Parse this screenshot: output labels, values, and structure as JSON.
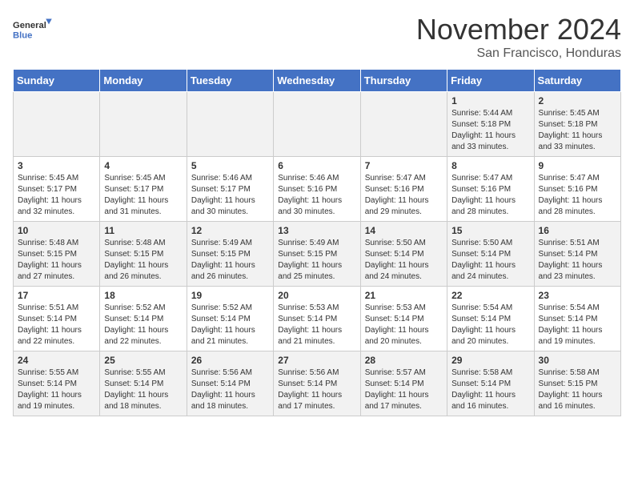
{
  "logo": {
    "line1": "General",
    "line2": "Blue"
  },
  "title": "November 2024",
  "subtitle": "San Francisco, Honduras",
  "weekdays": [
    "Sunday",
    "Monday",
    "Tuesday",
    "Wednesday",
    "Thursday",
    "Friday",
    "Saturday"
  ],
  "weeks": [
    [
      {
        "day": "",
        "info": ""
      },
      {
        "day": "",
        "info": ""
      },
      {
        "day": "",
        "info": ""
      },
      {
        "day": "",
        "info": ""
      },
      {
        "day": "",
        "info": ""
      },
      {
        "day": "1",
        "info": "Sunrise: 5:44 AM\nSunset: 5:18 PM\nDaylight: 11 hours and 33 minutes."
      },
      {
        "day": "2",
        "info": "Sunrise: 5:45 AM\nSunset: 5:18 PM\nDaylight: 11 hours and 33 minutes."
      }
    ],
    [
      {
        "day": "3",
        "info": "Sunrise: 5:45 AM\nSunset: 5:17 PM\nDaylight: 11 hours and 32 minutes."
      },
      {
        "day": "4",
        "info": "Sunrise: 5:45 AM\nSunset: 5:17 PM\nDaylight: 11 hours and 31 minutes."
      },
      {
        "day": "5",
        "info": "Sunrise: 5:46 AM\nSunset: 5:17 PM\nDaylight: 11 hours and 30 minutes."
      },
      {
        "day": "6",
        "info": "Sunrise: 5:46 AM\nSunset: 5:16 PM\nDaylight: 11 hours and 30 minutes."
      },
      {
        "day": "7",
        "info": "Sunrise: 5:47 AM\nSunset: 5:16 PM\nDaylight: 11 hours and 29 minutes."
      },
      {
        "day": "8",
        "info": "Sunrise: 5:47 AM\nSunset: 5:16 PM\nDaylight: 11 hours and 28 minutes."
      },
      {
        "day": "9",
        "info": "Sunrise: 5:47 AM\nSunset: 5:16 PM\nDaylight: 11 hours and 28 minutes."
      }
    ],
    [
      {
        "day": "10",
        "info": "Sunrise: 5:48 AM\nSunset: 5:15 PM\nDaylight: 11 hours and 27 minutes."
      },
      {
        "day": "11",
        "info": "Sunrise: 5:48 AM\nSunset: 5:15 PM\nDaylight: 11 hours and 26 minutes."
      },
      {
        "day": "12",
        "info": "Sunrise: 5:49 AM\nSunset: 5:15 PM\nDaylight: 11 hours and 26 minutes."
      },
      {
        "day": "13",
        "info": "Sunrise: 5:49 AM\nSunset: 5:15 PM\nDaylight: 11 hours and 25 minutes."
      },
      {
        "day": "14",
        "info": "Sunrise: 5:50 AM\nSunset: 5:14 PM\nDaylight: 11 hours and 24 minutes."
      },
      {
        "day": "15",
        "info": "Sunrise: 5:50 AM\nSunset: 5:14 PM\nDaylight: 11 hours and 24 minutes."
      },
      {
        "day": "16",
        "info": "Sunrise: 5:51 AM\nSunset: 5:14 PM\nDaylight: 11 hours and 23 minutes."
      }
    ],
    [
      {
        "day": "17",
        "info": "Sunrise: 5:51 AM\nSunset: 5:14 PM\nDaylight: 11 hours and 22 minutes."
      },
      {
        "day": "18",
        "info": "Sunrise: 5:52 AM\nSunset: 5:14 PM\nDaylight: 11 hours and 22 minutes."
      },
      {
        "day": "19",
        "info": "Sunrise: 5:52 AM\nSunset: 5:14 PM\nDaylight: 11 hours and 21 minutes."
      },
      {
        "day": "20",
        "info": "Sunrise: 5:53 AM\nSunset: 5:14 PM\nDaylight: 11 hours and 21 minutes."
      },
      {
        "day": "21",
        "info": "Sunrise: 5:53 AM\nSunset: 5:14 PM\nDaylight: 11 hours and 20 minutes."
      },
      {
        "day": "22",
        "info": "Sunrise: 5:54 AM\nSunset: 5:14 PM\nDaylight: 11 hours and 20 minutes."
      },
      {
        "day": "23",
        "info": "Sunrise: 5:54 AM\nSunset: 5:14 PM\nDaylight: 11 hours and 19 minutes."
      }
    ],
    [
      {
        "day": "24",
        "info": "Sunrise: 5:55 AM\nSunset: 5:14 PM\nDaylight: 11 hours and 19 minutes."
      },
      {
        "day": "25",
        "info": "Sunrise: 5:55 AM\nSunset: 5:14 PM\nDaylight: 11 hours and 18 minutes."
      },
      {
        "day": "26",
        "info": "Sunrise: 5:56 AM\nSunset: 5:14 PM\nDaylight: 11 hours and 18 minutes."
      },
      {
        "day": "27",
        "info": "Sunrise: 5:56 AM\nSunset: 5:14 PM\nDaylight: 11 hours and 17 minutes."
      },
      {
        "day": "28",
        "info": "Sunrise: 5:57 AM\nSunset: 5:14 PM\nDaylight: 11 hours and 17 minutes."
      },
      {
        "day": "29",
        "info": "Sunrise: 5:58 AM\nSunset: 5:14 PM\nDaylight: 11 hours and 16 minutes."
      },
      {
        "day": "30",
        "info": "Sunrise: 5:58 AM\nSunset: 5:15 PM\nDaylight: 11 hours and 16 minutes."
      }
    ]
  ]
}
